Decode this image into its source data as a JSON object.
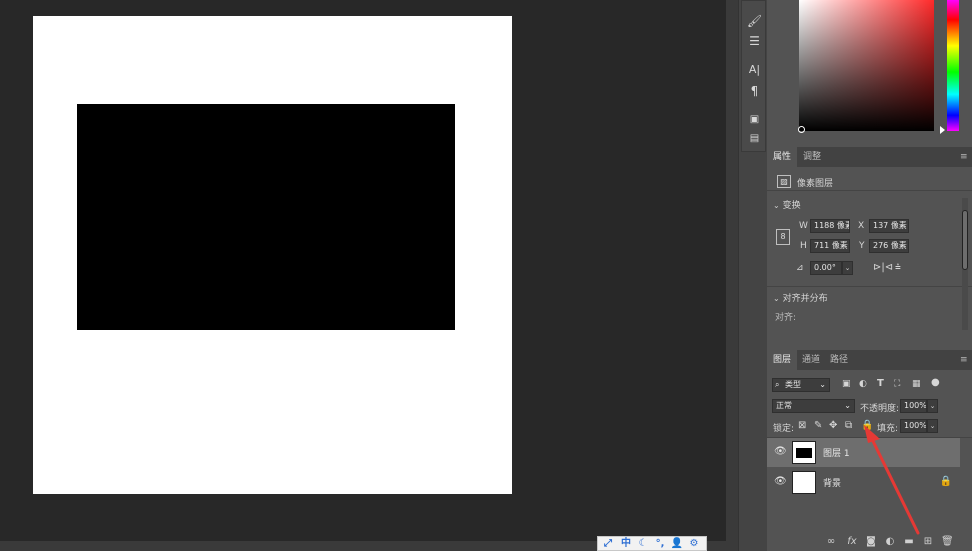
{
  "colors": {
    "accent_arrow": "#e53935",
    "canvas": "#ffffff",
    "shape": "#000000",
    "panel_bg": "#535353",
    "workspace_bg": "#282828"
  },
  "toolstrip": {
    "icons": [
      "brush-settings-icon",
      "adjust-sliders-icon",
      "character-icon",
      "paragraph-icon",
      "notes-icon",
      "document-icon"
    ],
    "character_glyph": "A|",
    "paragraph_glyph": "¶"
  },
  "properties": {
    "tabs": [
      "属性",
      "调整"
    ],
    "layer_type": "像素图层",
    "transform_title": "变换",
    "w_label": "W",
    "w_value": "1188 像素",
    "x_label": "X",
    "x_value": "137 像素",
    "h_label": "H",
    "h_value": "711 像素",
    "y_label": "Y",
    "y_value": "276 像素",
    "angle_value": "0.00°",
    "align_title": "对齐并分布",
    "align_label": "对齐:"
  },
  "layers": {
    "tabs": [
      "图层",
      "通道",
      "路径"
    ],
    "filter_kind": "类型",
    "blend_mode": "正常",
    "opacity_label": "不透明度:",
    "opacity_value": "100%",
    "lock_label": "锁定:",
    "fill_label": "填充:",
    "fill_value": "100%",
    "items": [
      {
        "name": "图层 1",
        "selected": true,
        "locked": false
      },
      {
        "name": "背景",
        "selected": false,
        "locked": true
      }
    ],
    "footer_fx": "fx"
  },
  "ime": {
    "mode": "中"
  }
}
